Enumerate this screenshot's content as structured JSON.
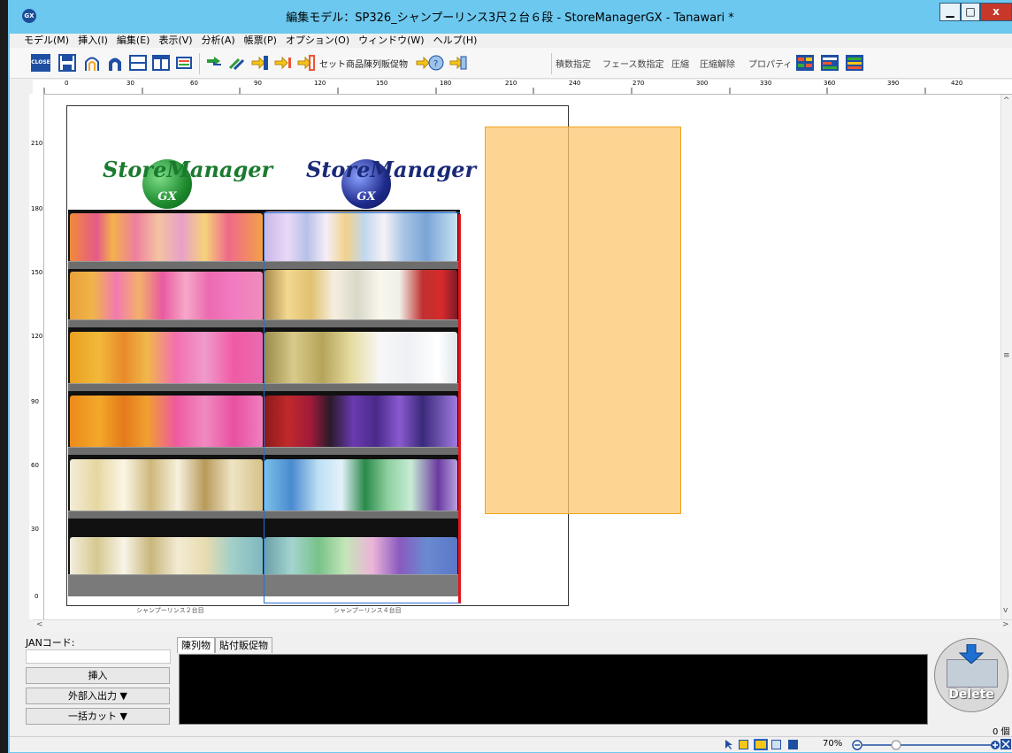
{
  "window": {
    "title": "編集モデル：SP326_シャンプーリンス3尺２台６段 - StoreManagerGX - Tanawari *",
    "app_icon": "GX",
    "min_glyph": "▁",
    "max_glyph": "□",
    "close_glyph": "x"
  },
  "menu": [
    "モデル(M)",
    "挿入(I)",
    "編集(E)",
    "表示(V)",
    "分析(A)",
    "帳票(P)",
    "オプション(O)",
    "ウィンドウ(W)",
    "ヘルプ(H)"
  ],
  "toolbar": {
    "close_label": "CLOSE",
    "set_item": "セット商品",
    "display_promo": "陳列販促物",
    "stack_spec": "積数指定",
    "face_spec": "フェース数指定",
    "compress": "圧縮",
    "uncompress": "圧縮解除",
    "property": "プロパティ"
  },
  "ruler": {
    "h_labels": [
      "0",
      "30",
      "60",
      "90",
      "120",
      "150",
      "180",
      "210",
      "240",
      "270",
      "300",
      "330",
      "360",
      "390",
      "420"
    ],
    "v_labels": [
      "210",
      "180",
      "150",
      "120",
      "90",
      "60",
      "30",
      "0"
    ]
  },
  "planogram": {
    "logo_text": "StoreManager",
    "logo_sub": "GX",
    "module_labels": [
      "シャンプーリンス２台目",
      "シャンプーリンス４台目"
    ]
  },
  "panel": {
    "jan_label": "JANコード:",
    "insert_button": "挿入",
    "io_button": "外部入出力 ▼",
    "cut_button": "一括カット ▼",
    "tabs": [
      "陳列物",
      "貼付販促物"
    ],
    "delete_label": "Delete",
    "count": "0 個"
  },
  "status": {
    "zoom": "70%"
  },
  "colors": {
    "titlebar": "#6cc8ef",
    "orange_area": "#fdc56e",
    "red_edge": "#e0161b"
  }
}
